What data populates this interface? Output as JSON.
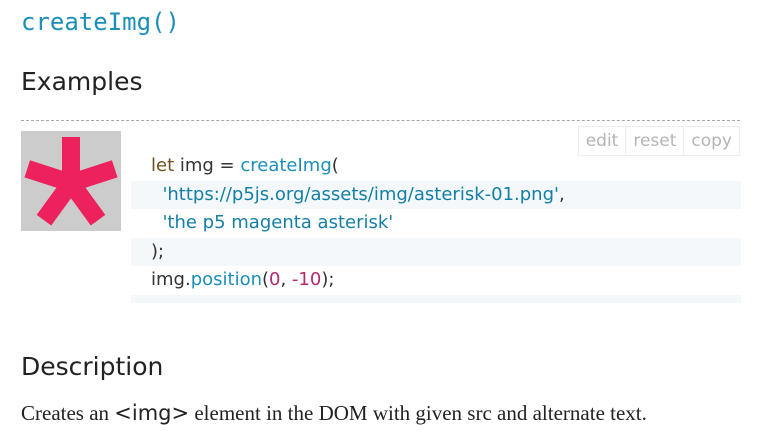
{
  "header": {
    "function_title": "createImg()"
  },
  "examples": {
    "heading": "Examples",
    "image_icon": "magenta-asterisk-icon",
    "image_colors": {
      "background": "#cccccc",
      "asterisk": "#ed225d"
    },
    "controls": {
      "edit_label": "edit",
      "reset_label": "reset",
      "copy_label": "copy"
    },
    "code": {
      "line1": {
        "kw": "let",
        "plain1": " img = ",
        "fn": "createImg",
        "plain2": "("
      },
      "line2": {
        "indent": "  ",
        "str": "'https://p5js.org/assets/img/asterisk-01.png'",
        "plain": ","
      },
      "line3": {
        "indent": "  ",
        "str": "'the p5 magenta asterisk'"
      },
      "line4": {
        "plain": ");"
      },
      "line5": {
        "obj": "img.",
        "fn": "position",
        "open": "(",
        "num1": "0",
        "sep": ", ",
        "num2": "-10",
        "close": ");"
      }
    }
  },
  "description": {
    "heading": "Description",
    "text_before": "Creates an ",
    "tag": "<img>",
    "text_after": " element in the DOM with given src and alternate text."
  }
}
